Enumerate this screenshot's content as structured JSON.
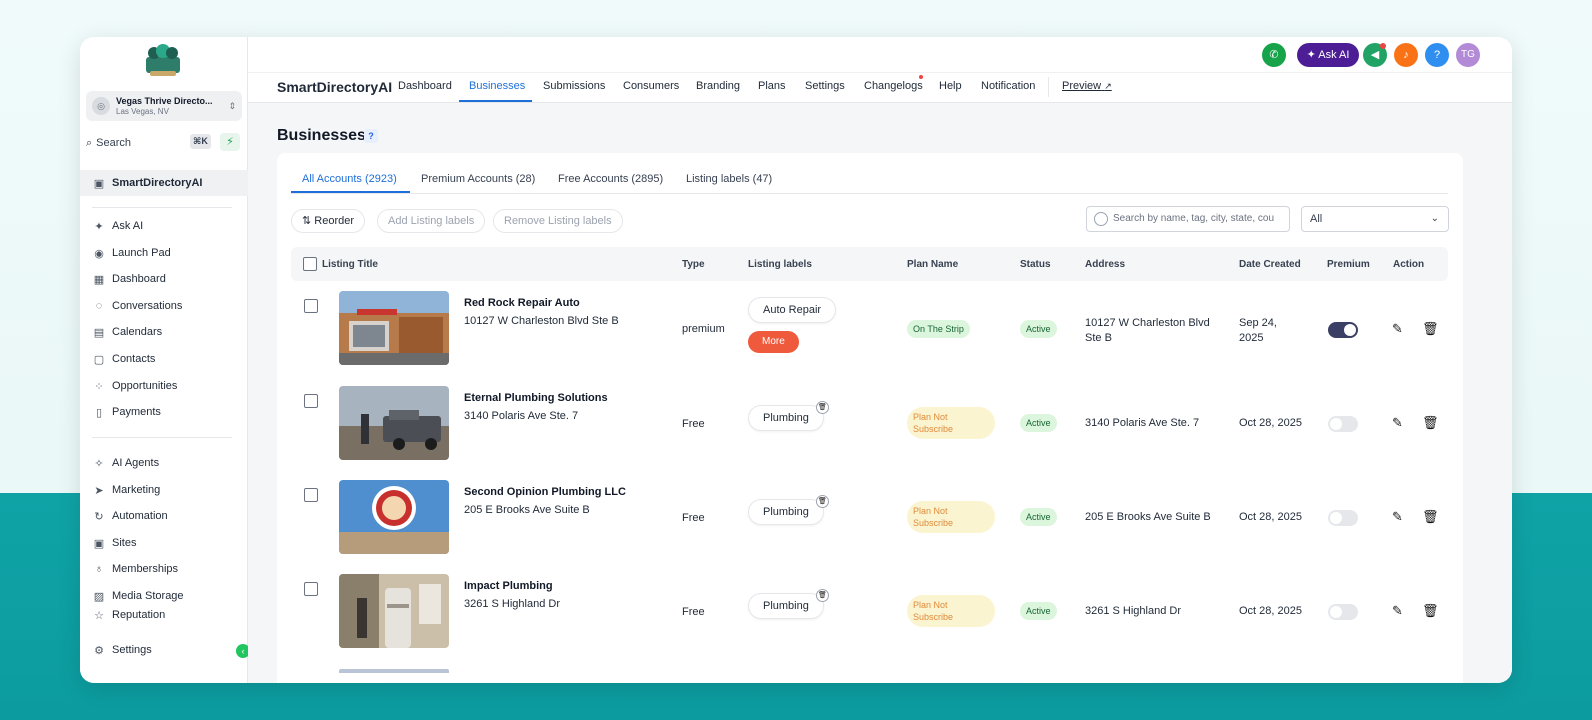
{
  "sidebar": {
    "location_name": "Vegas Thrive Directo...",
    "location_sub": "Las Vegas, NV",
    "search_label": "Search",
    "search_shortcut": "⌘K",
    "pinned": "SmartDirectoryAI",
    "items": [
      {
        "label": "Ask AI",
        "icon": "sparkle-icon"
      },
      {
        "label": "Launch Pad",
        "icon": "rocket-icon"
      },
      {
        "label": "Dashboard",
        "icon": "grid-icon"
      },
      {
        "label": "Conversations",
        "icon": "chat-icon"
      },
      {
        "label": "Calendars",
        "icon": "calendar-icon"
      },
      {
        "label": "Contacts",
        "icon": "contacts-icon"
      },
      {
        "label": "Opportunities",
        "icon": "opportunities-icon"
      },
      {
        "label": "Payments",
        "icon": "payments-icon"
      }
    ],
    "items2": [
      {
        "label": "AI Agents",
        "icon": "ai-agents-icon"
      },
      {
        "label": "Marketing",
        "icon": "send-icon"
      },
      {
        "label": "Automation",
        "icon": "automation-icon"
      },
      {
        "label": "Sites",
        "icon": "sites-icon"
      },
      {
        "label": "Memberships",
        "icon": "membership-icon"
      },
      {
        "label": "Media Storage",
        "icon": "image-icon"
      },
      {
        "label": "Reputation",
        "icon": "star-icon"
      }
    ],
    "settings_label": "Settings"
  },
  "topbar": {
    "ask_ai": "Ask AI",
    "help": "?",
    "avatar": "TG"
  },
  "nav": {
    "brand": "SmartDirectoryAI",
    "items": [
      "Dashboard",
      "Businesses",
      "Submissions",
      "Consumers",
      "Branding",
      "Plans",
      "Settings",
      "Changelogs",
      "Help",
      "Notification"
    ],
    "preview": "Preview"
  },
  "page": {
    "title": "Businesses",
    "help": "?"
  },
  "tabs": [
    "All Accounts (2923)",
    "Premium Accounts (28)",
    "Free Accounts (2895)",
    "Listing labels (47)"
  ],
  "toolbar": {
    "reorder": "Reorder",
    "add_labels": "Add Listing labels",
    "remove_labels": "Remove Listing labels",
    "search_placeholder": "Search by name, tag, city, state, cou",
    "filter_value": "All"
  },
  "columns": [
    "Listing Title",
    "Type",
    "Listing labels",
    "Plan Name",
    "Status",
    "Address",
    "Date Created",
    "Premium",
    "Action"
  ],
  "rows": [
    {
      "title": "Red Rock Repair Auto",
      "address": "10127 W Charleston Blvd Ste B",
      "type": "premium",
      "label": "Auto Repair",
      "more": "More",
      "plan": "On The Strip",
      "status": "Active",
      "address_col_1": "10127 W Charleston Blvd",
      "address_col_2": "Ste B",
      "date_1": "Sep 24,",
      "date_2": "2025",
      "premium": true
    },
    {
      "title": "Eternal Plumbing Solutions",
      "address": "3140 Polaris Ave Ste. 7",
      "type": "Free",
      "label": "Plumbing",
      "plan_1": "Plan Not",
      "plan_2": "Subscribe",
      "status": "Active",
      "address_col_1": "3140 Polaris Ave Ste. 7",
      "date_1": "Oct 28, 2025",
      "premium": false
    },
    {
      "title": "Second Opinion Plumbing LLC",
      "address": "205 E Brooks Ave Suite B",
      "type": "Free",
      "label": "Plumbing",
      "plan_1": "Plan Not",
      "plan_2": "Subscribe",
      "status": "Active",
      "address_col_1": "205 E Brooks Ave Suite B",
      "date_1": "Oct 28, 2025",
      "premium": false
    },
    {
      "title": "Impact Plumbing",
      "address": "3261 S Highland Dr",
      "type": "Free",
      "label": "Plumbing",
      "plan_1": "Plan Not",
      "plan_2": "Subscribe",
      "status": "Active",
      "address_col_1": "3261 S Highland Dr",
      "date_1": "Oct 28, 2025",
      "premium": false
    }
  ],
  "colors": {
    "accent": "#1e6fd9",
    "ask_ai": "#4c1d95",
    "more_chip": "#ef5a3c",
    "active_green": "#dcf5dd",
    "plan_orange": "#fbf4d0"
  }
}
